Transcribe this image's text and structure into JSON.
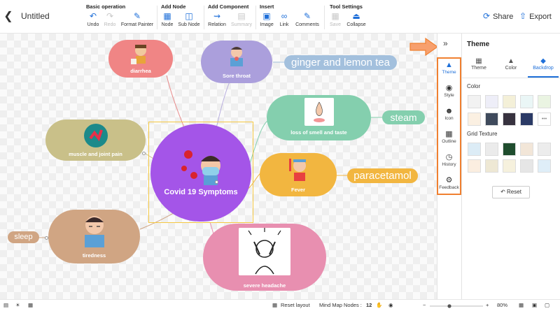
{
  "header": {
    "title": "Untitled",
    "groups": [
      "Basic operation",
      "Add Node",
      "Add Component",
      "Insert",
      "Tool Settings"
    ],
    "buttons": {
      "undo": "Undo",
      "redo": "Redo",
      "format_painter": "Format Painter",
      "node": "Node",
      "sub_node": "Sub Node",
      "relation": "Relation",
      "summary": "Summary",
      "image": "Image",
      "link": "Link",
      "comments": "Comments",
      "save": "Save",
      "collapse": "Collapse"
    },
    "share": "Share",
    "export": "Export"
  },
  "mindmap": {
    "central": "Covid 19 Symptoms",
    "nodes": {
      "diarrhea": "diarrhea",
      "sore_throat": "Sore throat",
      "muscle": "muscle and joint pain",
      "loss": "loss of smell and taste",
      "fever": "Fever",
      "tiredness": "tiredness",
      "headache": "severe headache"
    },
    "tags": {
      "ginger": "ginger and lemon tea",
      "steam": "steam",
      "paracetamol": "paracetamol",
      "sleep": "sleep"
    }
  },
  "sidebar": {
    "items": [
      "Theme",
      "Style",
      "Icon",
      "Outline",
      "History",
      "Feedback"
    ],
    "active": "Theme"
  },
  "panel": {
    "title": "Theme",
    "tabs": [
      "Theme",
      "Color",
      "Backdrop"
    ],
    "active_tab": "Backdrop",
    "color_label": "Color",
    "grid_label": "Grid Texture",
    "more": "•••",
    "reset": "Reset",
    "colors": [
      "#f2f2f2",
      "#eeeef8",
      "#f4f0d8",
      "#eaf6f6",
      "#eaf4e2",
      "#fbf0e2",
      "#3f4a5c",
      "#37323f",
      "#2b3a66",
      "#ffffff"
    ],
    "textures": [
      "#dcecf6",
      "#ebebeb",
      "#1f4d2e",
      "#f2e6d8",
      "#ececec",
      "#fbeee0",
      "#eee8d4",
      "#f6f1dd",
      "#e6e6e6",
      "#dfeef8"
    ]
  },
  "statusbar": {
    "reset_layout": "Reset layout",
    "node_label": "Mind Map Nodes :",
    "node_count": "12",
    "zoom": "80%"
  },
  "colors": {
    "accent": "#1e6fd9",
    "central": "#a455e8",
    "annotation": "#f08030"
  }
}
